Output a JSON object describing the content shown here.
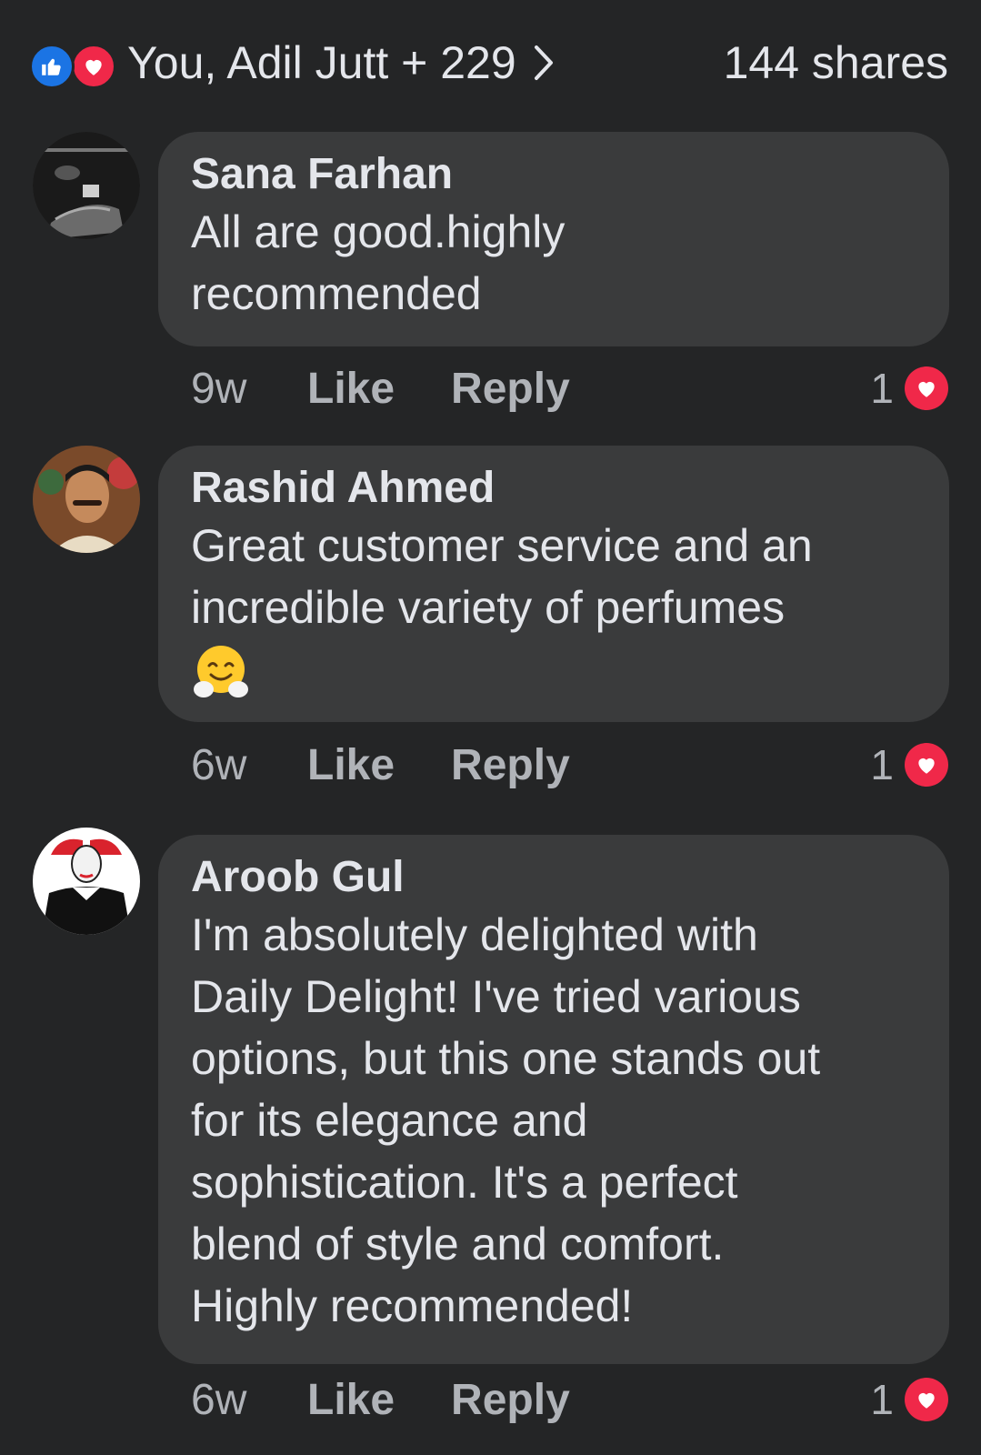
{
  "header": {
    "reactors_text": "You, Adil Jutt + 229",
    "shares_text": "144 shares"
  },
  "comments": [
    {
      "author": "Sana Farhan",
      "lines": [
        "All are good.highly",
        "recommended"
      ],
      "time": "9w",
      "like_label": "Like",
      "reply_label": "Reply",
      "reaction_count": "1"
    },
    {
      "author": "Rashid Ahmed",
      "lines": [
        "Great customer service and an",
        "incredible variety of perfumes"
      ],
      "emoji": "hugging-face",
      "time": "6w",
      "like_label": "Like",
      "reply_label": "Reply",
      "reaction_count": "1"
    },
    {
      "author": "Aroob Gul",
      "lines": [
        "I'm absolutely delighted with",
        "Daily Delight! I've tried various",
        "options, but this one stands out",
        "for its elegance and",
        "sophistication. It's a perfect",
        "blend of style and comfort.",
        "Highly recommended!"
      ],
      "time": "6w",
      "like_label": "Like",
      "reply_label": "Reply",
      "reaction_count": "1"
    }
  ],
  "colors": {
    "background": "#242526",
    "bubble": "#3a3b3c",
    "like_blue": "#1b74e4",
    "love_red": "#f02849",
    "secondary_text": "#b0b3b8"
  }
}
